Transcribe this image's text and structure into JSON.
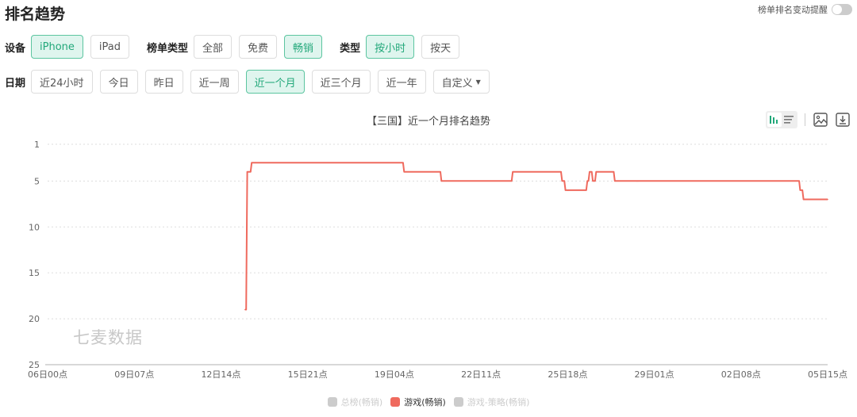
{
  "header": {
    "title": "排名趋势",
    "alert_label": "榜单排名变动提醒",
    "alert_enabled": false
  },
  "filters": {
    "device": {
      "label": "设备",
      "options": [
        "iPhone",
        "iPad"
      ],
      "selected": "iPhone"
    },
    "chart_type": {
      "label": "榜单类型",
      "options": [
        "全部",
        "免费",
        "畅销"
      ],
      "selected": "畅销"
    },
    "granularity": {
      "label": "类型",
      "options": [
        "按小时",
        "按天"
      ],
      "selected": "按小时"
    },
    "date": {
      "label": "日期",
      "options": [
        "近24小时",
        "今日",
        "昨日",
        "近一周",
        "近一个月",
        "近三个月",
        "近一年"
      ],
      "selected": "近一个月",
      "custom_label": "自定义"
    }
  },
  "toolbar": {
    "icons": [
      "bar-view-icon",
      "list-view-icon",
      "image-export-icon",
      "download-icon"
    ]
  },
  "watermark": "七麦数据",
  "colors": {
    "accent": "#22a87a",
    "series": "#ef6a5e",
    "inactive": "#cccccc"
  },
  "chart_data": {
    "type": "line",
    "title": "【三国】近一个月排名趋势",
    "xlabel": "",
    "ylabel": "",
    "ylim": [
      1,
      25
    ],
    "y_inverted": true,
    "y_ticks": [
      1,
      5,
      10,
      15,
      20,
      25
    ],
    "x_unit": "hours since 06日00点",
    "xlim": [
      0,
      711
    ],
    "x_tick_labels": [
      "06日00点",
      "09日07点",
      "12日14点",
      "15日21点",
      "19日04点",
      "22日11点",
      "25日18点",
      "29日01点",
      "02日08点",
      "05日15点"
    ],
    "x_tick_values": [
      0,
      79,
      158,
      237,
      316,
      395,
      474,
      553,
      632,
      711
    ],
    "grid": true,
    "legend": [
      {
        "name": "总榜(畅销)",
        "active": false
      },
      {
        "name": "游戏(畅销)",
        "active": true
      },
      {
        "name": "游戏-策略(畅销)",
        "active": false
      }
    ],
    "legend_position": "bottom-center",
    "series": [
      {
        "name": "游戏(畅销)",
        "x": [
          180,
          181,
          182,
          185,
          186,
          190,
          324,
          325,
          358,
          359,
          423,
          424,
          468,
          469,
          471,
          472,
          474,
          475,
          491,
          492,
          493,
          494,
          496,
          497,
          499,
          500,
          516,
          517,
          537,
          538,
          685,
          686,
          688,
          689,
          711
        ],
        "values": [
          19,
          19,
          4,
          4,
          3,
          3,
          3,
          4,
          4,
          5,
          5,
          4,
          4,
          5,
          5,
          6,
          6,
          6,
          6,
          5,
          5,
          4,
          4,
          5,
          5,
          4,
          4,
          5,
          5,
          5,
          5,
          6,
          6,
          7,
          7
        ]
      }
    ]
  }
}
